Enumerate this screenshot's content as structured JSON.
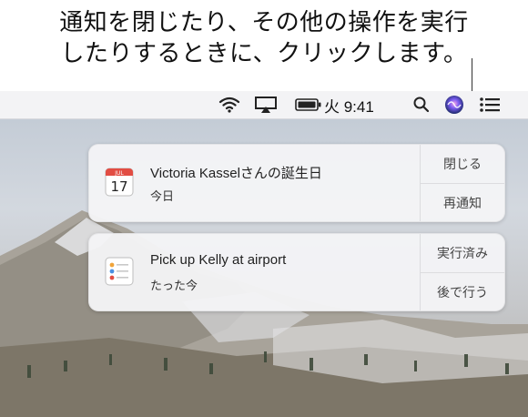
{
  "caption": {
    "line1": "通知を閉じたり、その他の操作を実行",
    "line2": "したりするときに、クリックします。"
  },
  "menubar": {
    "icons": [
      "wifi-icon",
      "airplay-icon",
      "battery-icon",
      "search-icon",
      "siri-icon",
      "notification-center-icon"
    ],
    "clock": "火 9:41"
  },
  "notifications": [
    {
      "app_icon": "calendar-icon",
      "calendar_day": "17",
      "calendar_month": "JUL",
      "title": "Victoria Kasselさんの誕生日",
      "subtitle": "今日",
      "actions": [
        "閉じる",
        "再通知"
      ]
    },
    {
      "app_icon": "reminders-icon",
      "title": "Pick up Kelly at airport",
      "subtitle": "たった今",
      "actions": [
        "実行済み",
        "後で行う"
      ]
    }
  ]
}
